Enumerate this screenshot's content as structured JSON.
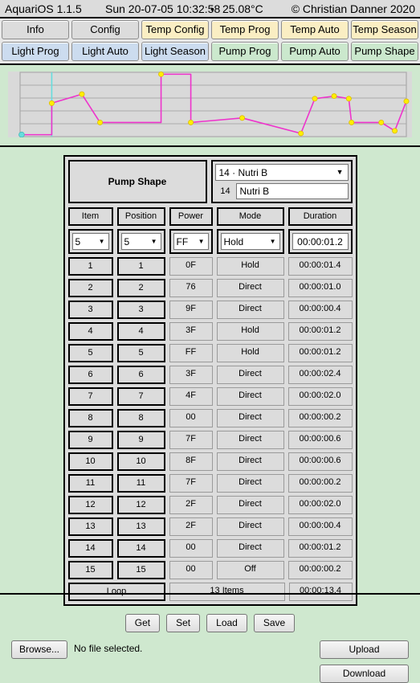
{
  "titlebar": {
    "app": "AquariOS 1.1.5",
    "datetime": "Sun 20-07-05 10:32:58",
    "separator": "•",
    "temperature": "25.08°C",
    "copyright": "© Christian Danner 2020"
  },
  "nav": {
    "row1": [
      {
        "label": "Info",
        "color": "gray"
      },
      {
        "label": "Config",
        "color": "gray"
      },
      {
        "label": "Temp Config",
        "color": "yellow"
      },
      {
        "label": "Temp Prog",
        "color": "yellow"
      },
      {
        "label": "Temp Auto",
        "color": "yellow"
      },
      {
        "label": "Temp Season",
        "color": "yellow"
      }
    ],
    "row2": [
      {
        "label": "Light Prog",
        "color": "blue"
      },
      {
        "label": "Light Auto",
        "color": "blue"
      },
      {
        "label": "Light Season",
        "color": "blue"
      },
      {
        "label": "Pump Prog",
        "color": "green"
      },
      {
        "label": "Pump Auto",
        "color": "green"
      },
      {
        "label": "Pump Shape",
        "color": "green"
      }
    ]
  },
  "chart_data": {
    "type": "line",
    "title": "",
    "xlabel": "",
    "ylabel": "",
    "grid": true,
    "legend": false,
    "xlim": [
      0,
      100
    ],
    "ylim": [
      0,
      100
    ],
    "gridlines_y": [
      20,
      40,
      60,
      80
    ],
    "plot_bg": "#d9d9d9",
    "line_color": "#ee33cc",
    "marker_color": "#ffee00",
    "marker_edge": "#ddbb00",
    "cursor_color": "#66dddd",
    "cursor_x": 8.2,
    "start_marker": {
      "x": 0.4,
      "y": 3,
      "color": "#66dddd"
    },
    "x": [
      0.4,
      8.2,
      8.2,
      16.0,
      16.0,
      20.7,
      20.7,
      36.5,
      36.5,
      44.2,
      44.2,
      51.2,
      57.5,
      72.7,
      72.7,
      76.3,
      81.3,
      81.3,
      85.1,
      93.5,
      93.5,
      97.0,
      100.0
    ],
    "y": [
      3,
      3,
      52,
      52,
      66,
      66,
      22,
      22,
      97,
      97,
      22,
      22,
      29,
      29,
      5,
      5,
      59,
      63,
      59,
      59,
      22,
      22,
      9,
      9,
      55
    ],
    "points": [
      {
        "x": 0.4,
        "y": 3
      },
      {
        "x": 8.2,
        "y": 52
      },
      {
        "x": 16.0,
        "y": 66
      },
      {
        "x": 20.7,
        "y": 22
      },
      {
        "x": 36.5,
        "y": 97
      },
      {
        "x": 44.2,
        "y": 22
      },
      {
        "x": 57.5,
        "y": 29
      },
      {
        "x": 72.7,
        "y": 5
      },
      {
        "x": 76.3,
        "y": 59
      },
      {
        "x": 81.3,
        "y": 63
      },
      {
        "x": 85.1,
        "y": 59
      },
      {
        "x": 85.8,
        "y": 22
      },
      {
        "x": 93.5,
        "y": 22
      },
      {
        "x": 97.0,
        "y": 9
      },
      {
        "x": 100.0,
        "y": 55
      }
    ]
  },
  "panel": {
    "title": "Pump Shape",
    "selector": {
      "value": "14 · Nutri B",
      "caret": "▼",
      "id": "14",
      "name": "Nutri B"
    },
    "columns": [
      "Item",
      "Position",
      "Power",
      "Mode",
      "Duration"
    ],
    "editor": {
      "item": "5",
      "position": "5",
      "power": "FF",
      "mode": "Hold",
      "duration": "00:00:01.2",
      "caret": "▼"
    },
    "rows": [
      {
        "item": "1",
        "position": "1",
        "power": "0F",
        "mode": "Hold",
        "duration": "00:00:01.4"
      },
      {
        "item": "2",
        "position": "2",
        "power": "76",
        "mode": "Direct",
        "duration": "00:00:01.0"
      },
      {
        "item": "3",
        "position": "3",
        "power": "9F",
        "mode": "Direct",
        "duration": "00:00:00.4"
      },
      {
        "item": "4",
        "position": "4",
        "power": "3F",
        "mode": "Hold",
        "duration": "00:00:01.2"
      },
      {
        "item": "5",
        "position": "5",
        "power": "FF",
        "mode": "Hold",
        "duration": "00:00:01.2"
      },
      {
        "item": "6",
        "position": "6",
        "power": "3F",
        "mode": "Direct",
        "duration": "00:00:02.4"
      },
      {
        "item": "7",
        "position": "7",
        "power": "4F",
        "mode": "Direct",
        "duration": "00:00:02.0"
      },
      {
        "item": "8",
        "position": "8",
        "power": "00",
        "mode": "Direct",
        "duration": "00:00:00.2"
      },
      {
        "item": "9",
        "position": "9",
        "power": "7F",
        "mode": "Direct",
        "duration": "00:00:00.6"
      },
      {
        "item": "10",
        "position": "10",
        "power": "8F",
        "mode": "Direct",
        "duration": "00:00:00.6"
      },
      {
        "item": "11",
        "position": "11",
        "power": "7F",
        "mode": "Direct",
        "duration": "00:00:00.2"
      },
      {
        "item": "12",
        "position": "12",
        "power": "2F",
        "mode": "Direct",
        "duration": "00:00:02.0"
      },
      {
        "item": "13",
        "position": "13",
        "power": "2F",
        "mode": "Direct",
        "duration": "00:00:00.4"
      },
      {
        "item": "14",
        "position": "14",
        "power": "00",
        "mode": "Direct",
        "duration": "00:00:01.2"
      },
      {
        "item": "15",
        "position": "15",
        "power": "00",
        "mode": "Off",
        "duration": "00:00:00.2"
      }
    ],
    "footer": {
      "loop": "Loop",
      "items": "13 Items",
      "total": "00:00:13.4"
    }
  },
  "actions": {
    "get": "Get",
    "set": "Set",
    "load": "Load",
    "save": "Save",
    "browse": "Browse...",
    "nofile": "No file selected.",
    "upload": "Upload",
    "download": "Download"
  }
}
